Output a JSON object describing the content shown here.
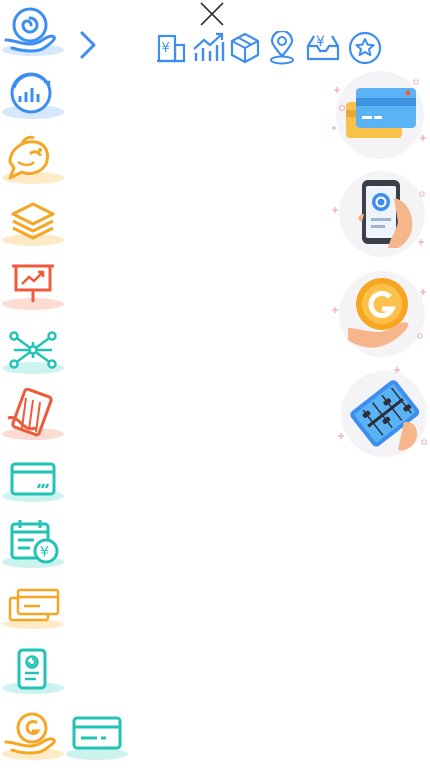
{
  "icons": {
    "left_column": [
      "hand-swirl-icon",
      "chart-swirl-icon",
      "fish-icon",
      "layers-icon",
      "presentation-chart-icon",
      "network-nodes-icon",
      "abacus-hand-icon",
      "card-icon",
      "calendar-yen-icon",
      "stacked-cards-icon",
      "phone-swirl-icon",
      "coin-hand-icon",
      "card-small-icon"
    ],
    "top_row": [
      "building-yen-icon",
      "bar-growth-icon",
      "cube-icon",
      "location-pin-icon",
      "inbox-yen-icon",
      "star-circle-icon"
    ],
    "illustrations": [
      "cards-illustration",
      "phone-hand-illustration",
      "coin-hand-illustration",
      "abacus-illustration"
    ]
  },
  "colors": {
    "blue": "#3d8ef0",
    "blue_light": "#d6e8fb",
    "orange": "#f5a623",
    "orange_light": "#fdebc8",
    "red": "#ef5a3a",
    "red_light": "#fcdcd2",
    "teal": "#22c3b6",
    "teal_light": "#cdf3ee",
    "pink": "#f4d4dc"
  },
  "top_row_glyphs": {
    "building": "¥",
    "inbox": "¥",
    "star": "☆"
  },
  "calendar_glyph": "¥"
}
